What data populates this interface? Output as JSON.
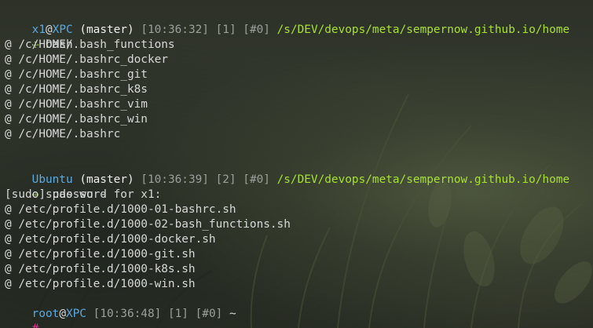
{
  "theme": {
    "user_color": "#5ca8e0",
    "path_color": "#a6e22e",
    "bracket_color": "#9aa09a",
    "text_color": "#d8d8d8",
    "prompt_symbol_color": "#9ad35a",
    "root_hash_color": "#e0309a"
  },
  "block1": {
    "host": "x1",
    "at": "@",
    "machine": "XPC",
    "branch": "(master)",
    "time": "[10:36:32]",
    "jobs": "[1]",
    "hist": "[#0]",
    "cwd": "/s/DEV/devops/meta/sempernow.github.io/home",
    "prompt_symbol": "☩",
    "command": "bash",
    "outputs": [
      "@ /c/HOME/.bash_functions",
      "@ /c/HOME/.bashrc_docker",
      "@ /c/HOME/.bashrc_git",
      "@ /c/HOME/.bashrc_k8s",
      "@ /c/HOME/.bashrc_vim",
      "@ /c/HOME/.bashrc_win",
      "@ /c/HOME/.bashrc"
    ]
  },
  "block2": {
    "host": "Ubuntu",
    "branch": "(master)",
    "time": "[10:36:39]",
    "jobs": "[2]",
    "hist": "[#0]",
    "cwd": "/s/DEV/devops/meta/sempernow.github.io/home",
    "prompt_symbol": "☩",
    "command": "sudo su -",
    "sudo_prompt": "[sudo] password for x1:",
    "outputs": [
      "@ /etc/profile.d/1000-01-bashrc.sh",
      "@ /etc/profile.d/1000-02-bash_functions.sh",
      "@ /etc/profile.d/1000-docker.sh",
      "@ /etc/profile.d/1000-git.sh",
      "@ /etc/profile.d/1000-k8s.sh",
      "@ /etc/profile.d/1000-win.sh"
    ]
  },
  "block3": {
    "host": "root",
    "at": "@",
    "machine": "XPC",
    "time": "[10:36:48]",
    "jobs": "[1]",
    "hist": "[#0]",
    "cwd": "~",
    "prompt_symbol": "#"
  }
}
